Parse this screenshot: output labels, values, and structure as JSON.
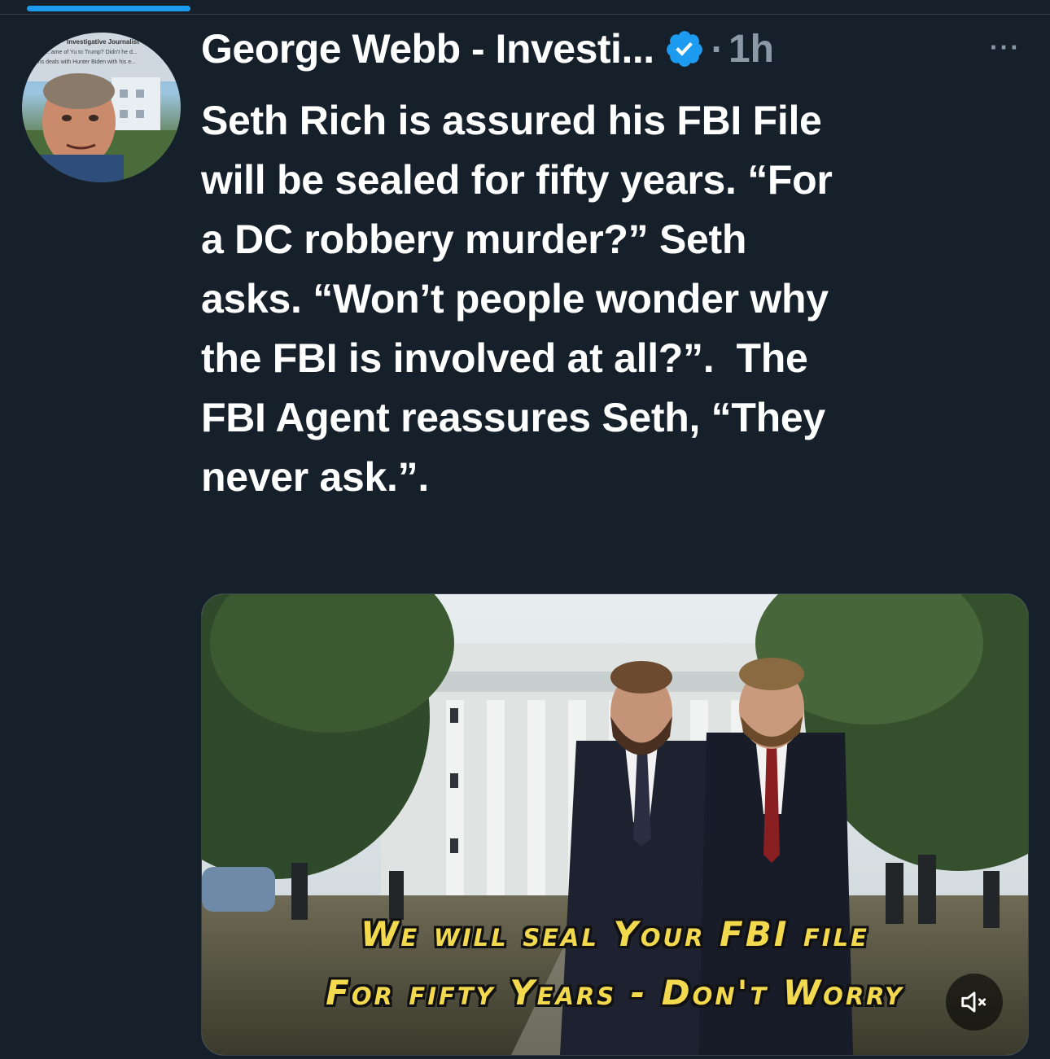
{
  "tweet": {
    "author_name": "George Webb - Investi...",
    "verified": true,
    "time": "1h",
    "separator": "·",
    "more_label": "···",
    "text": "Seth Rich is assured his FBI File\nwill be sealed for fifty years. “For\na DC robbery murder?” Seth\nasks. “Won’t people wonder why\nthe FBI is involved at all?”.  The\nFBI Agent reassures Seth, “They\nnever ask.”."
  },
  "avatar": {
    "overlay_line_1": "Investigative Journalist",
    "overlay_line_2": "...ame of Yu to Trump? Didn't he d...",
    "overlay_line_3": "...ons deals with Hunter Biden with his e..."
  },
  "media": {
    "caption_line_1": "We will seal Your FBI file",
    "caption_line_2": "For fifty Years - Don't Worry",
    "mute_icon": "volume-muted-icon"
  },
  "colors": {
    "background": "#15202b",
    "accent": "#1d9bf0",
    "secondary_text": "#8b98a5",
    "caption": "#f2d94e"
  }
}
